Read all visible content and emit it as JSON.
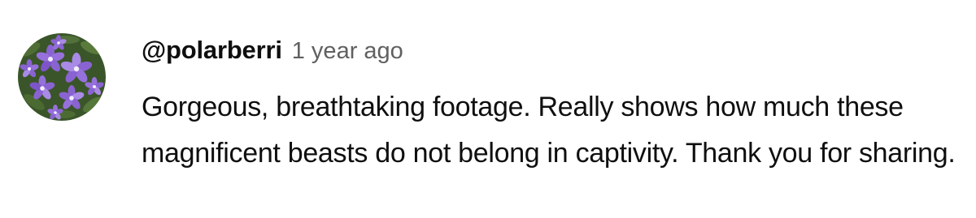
{
  "comment": {
    "author": "@polarberri",
    "timestamp": "1 year ago",
    "text": "Gorgeous, breathtaking footage. Really shows how much these magnificent beasts do not belong in captivity. Thank you for sharing."
  },
  "avatar": {
    "icon": "purple-flowers-photo",
    "colors": {
      "foliage": "#3f5a2c",
      "petal": "#8a63d2",
      "petal_light": "#a98ae6",
      "center": "#f2eefc"
    }
  }
}
